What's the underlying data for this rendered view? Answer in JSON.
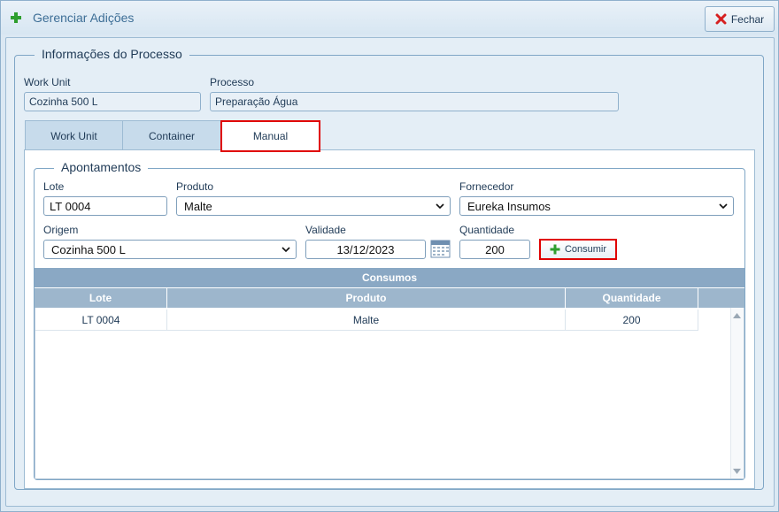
{
  "window": {
    "title": "Gerenciar Adições",
    "close_label": "Fechar"
  },
  "process_info": {
    "legend": "Informações do Processo",
    "work_unit_label": "Work Unit",
    "work_unit_value": "Cozinha 500 L",
    "processo_label": "Processo",
    "processo_value": "Preparação Água"
  },
  "tabs": [
    {
      "label": "Work Unit",
      "active": false
    },
    {
      "label": "Container",
      "active": false
    },
    {
      "label": "Manual",
      "active": true
    }
  ],
  "apontamentos": {
    "legend": "Apontamentos",
    "lote_label": "Lote",
    "lote_value": "LT 0004",
    "produto_label": "Produto",
    "produto_value": "Malte",
    "fornecedor_label": "Fornecedor",
    "fornecedor_value": "Eureka Insumos",
    "origem_label": "Origem",
    "origem_value": "Cozinha 500 L",
    "validade_label": "Validade",
    "validade_value": "13/12/2023",
    "quantidade_label": "Quantidade",
    "quantidade_value": "200",
    "consume_label": "Consumir"
  },
  "consumos": {
    "title": "Consumos",
    "columns": [
      "Lote",
      "Produto",
      "Quantidade"
    ],
    "rows": [
      [
        "LT 0004",
        "Malte",
        "200"
      ]
    ]
  },
  "colors": {
    "accent_red": "#e00000",
    "plus_green": "#2e9e2e",
    "header_blue": "#8aa8c4"
  }
}
